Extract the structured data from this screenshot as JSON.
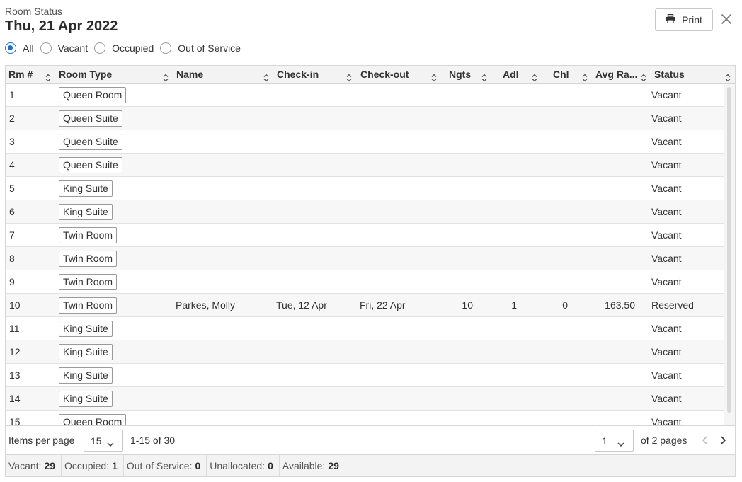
{
  "header": {
    "subtitle": "Room Status",
    "title": "Thu, 21 Apr 2022"
  },
  "actions": {
    "print_label": "Print"
  },
  "filters": [
    {
      "label": "All",
      "checked": true
    },
    {
      "label": "Vacant",
      "checked": false
    },
    {
      "label": "Occupied",
      "checked": false
    },
    {
      "label": "Out of Service",
      "checked": false
    }
  ],
  "columns": [
    "Rm #",
    "Room Type",
    "Name",
    "Check-in",
    "Check-out",
    "Ngts",
    "Adl",
    "Chl",
    "Avg Ra...",
    "Status"
  ],
  "rows": [
    {
      "rm": "1",
      "type": "Queen Room",
      "name": "",
      "checkin": "",
      "checkout": "",
      "ngts": "",
      "adl": "",
      "chl": "",
      "rate": "",
      "status": "Vacant"
    },
    {
      "rm": "2",
      "type": "Queen Suite",
      "name": "",
      "checkin": "",
      "checkout": "",
      "ngts": "",
      "adl": "",
      "chl": "",
      "rate": "",
      "status": "Vacant"
    },
    {
      "rm": "3",
      "type": "Queen Suite",
      "name": "",
      "checkin": "",
      "checkout": "",
      "ngts": "",
      "adl": "",
      "chl": "",
      "rate": "",
      "status": "Vacant"
    },
    {
      "rm": "4",
      "type": "Queen Suite",
      "name": "",
      "checkin": "",
      "checkout": "",
      "ngts": "",
      "adl": "",
      "chl": "",
      "rate": "",
      "status": "Vacant"
    },
    {
      "rm": "5",
      "type": "King Suite",
      "name": "",
      "checkin": "",
      "checkout": "",
      "ngts": "",
      "adl": "",
      "chl": "",
      "rate": "",
      "status": "Vacant"
    },
    {
      "rm": "6",
      "type": "King Suite",
      "name": "",
      "checkin": "",
      "checkout": "",
      "ngts": "",
      "adl": "",
      "chl": "",
      "rate": "",
      "status": "Vacant"
    },
    {
      "rm": "7",
      "type": "Twin Room",
      "name": "",
      "checkin": "",
      "checkout": "",
      "ngts": "",
      "adl": "",
      "chl": "",
      "rate": "",
      "status": "Vacant"
    },
    {
      "rm": "8",
      "type": "Twin Room",
      "name": "",
      "checkin": "",
      "checkout": "",
      "ngts": "",
      "adl": "",
      "chl": "",
      "rate": "",
      "status": "Vacant"
    },
    {
      "rm": "9",
      "type": "Twin Room",
      "name": "",
      "checkin": "",
      "checkout": "",
      "ngts": "",
      "adl": "",
      "chl": "",
      "rate": "",
      "status": "Vacant"
    },
    {
      "rm": "10",
      "type": "Twin Room",
      "name": "Parkes, Molly",
      "checkin": "Tue, 12 Apr",
      "checkout": "Fri, 22 Apr",
      "ngts": "10",
      "adl": "1",
      "chl": "0",
      "rate": "163.50",
      "status": "Reserved"
    },
    {
      "rm": "11",
      "type": "King Suite",
      "name": "",
      "checkin": "",
      "checkout": "",
      "ngts": "",
      "adl": "",
      "chl": "",
      "rate": "",
      "status": "Vacant"
    },
    {
      "rm": "12",
      "type": "King Suite",
      "name": "",
      "checkin": "",
      "checkout": "",
      "ngts": "",
      "adl": "",
      "chl": "",
      "rate": "",
      "status": "Vacant"
    },
    {
      "rm": "13",
      "type": "King Suite",
      "name": "",
      "checkin": "",
      "checkout": "",
      "ngts": "",
      "adl": "",
      "chl": "",
      "rate": "",
      "status": "Vacant"
    },
    {
      "rm": "14",
      "type": "King Suite",
      "name": "",
      "checkin": "",
      "checkout": "",
      "ngts": "",
      "adl": "",
      "chl": "",
      "rate": "",
      "status": "Vacant"
    },
    {
      "rm": "15",
      "type": "Queen Room",
      "name": "",
      "checkin": "",
      "checkout": "",
      "ngts": "",
      "adl": "",
      "chl": "",
      "rate": "",
      "status": "Vacant"
    }
  ],
  "pager": {
    "items_per_page_label": "Items per page",
    "items_per_page": "15",
    "range": "1-15 of 30",
    "page": "1",
    "of_pages": "of 2 pages"
  },
  "summary": [
    {
      "label": "Vacant:",
      "value": "29"
    },
    {
      "label": "Occupied:",
      "value": "1"
    },
    {
      "label": "Out of Service:",
      "value": "0"
    },
    {
      "label": "Unallocated:",
      "value": "0"
    },
    {
      "label": "Available:",
      "value": "29"
    }
  ],
  "colors": {
    "accent": "#1f6fd1",
    "header_bg": "#f3f3f3",
    "row_alt": "#f7f7f7",
    "border": "#d6d6d6"
  },
  "icons": {
    "print": "printer-icon",
    "close": "close-icon",
    "sort": "sort-icon",
    "chevron": "chevron-down-icon",
    "prev": "chevron-left-icon",
    "next": "chevron-right-icon"
  }
}
